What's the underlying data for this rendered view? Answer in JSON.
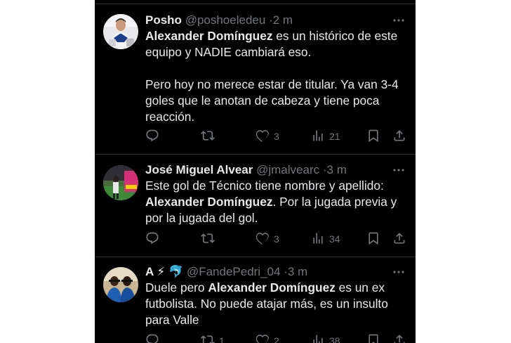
{
  "tweets": [
    {
      "name": "Posho",
      "handle": "@poshoeledeu",
      "time": "2 m",
      "body_lines": [
        [
          {
            "b": "Alexander Domínguez"
          },
          {
            "t": " es un histórico de este"
          }
        ],
        [
          {
            "t": "equipo y NADIE cambiará eso."
          }
        ],
        [],
        [
          {
            "t": "Pero hoy no merece estar de titular. Ya van 3-4"
          }
        ],
        [
          {
            "t": "goles que le anotan de cabeza y tiene poca"
          }
        ],
        [
          {
            "t": "reacción."
          }
        ]
      ],
      "replies": "",
      "retweets": "",
      "likes": "3",
      "views": "21"
    },
    {
      "name": "José Miguel Alvear",
      "handle": "@jmalvearc",
      "time": "3 m",
      "body_lines": [
        [
          {
            "t": "Este gol de Técnico tiene nombre y apellido:"
          }
        ],
        [
          {
            "b": "Alexander Domínguez"
          },
          {
            "t": ". Por la jugada previa y"
          }
        ],
        [
          {
            "t": "por la jugada del gol."
          }
        ]
      ],
      "replies": "",
      "retweets": "",
      "likes": "3",
      "views": "34"
    },
    {
      "name": "A ⚡ 🐬",
      "handle": "@FandePedri_04",
      "time": "3 m",
      "body_lines": [
        [
          {
            "t": "Duele pero "
          },
          {
            "b": "Alexander Domínguez"
          },
          {
            "t": " es un ex"
          }
        ],
        [
          {
            "t": "futbolista. No puede atajar más, es un insulto"
          }
        ],
        [
          {
            "t": "para Valle"
          }
        ]
      ],
      "replies": "",
      "retweets": "1",
      "likes": "2",
      "views": "38"
    }
  ],
  "icons": {
    "reply": "reply-icon",
    "retweet": "retweet-icon",
    "like": "like-icon",
    "views": "views-icon",
    "bookmark": "bookmark-icon",
    "share": "share-icon",
    "more": "more-icon"
  },
  "colors": {
    "background": "#000000",
    "text": "#e7e9ea",
    "secondary": "#71767b",
    "divider": "#2f3336"
  }
}
